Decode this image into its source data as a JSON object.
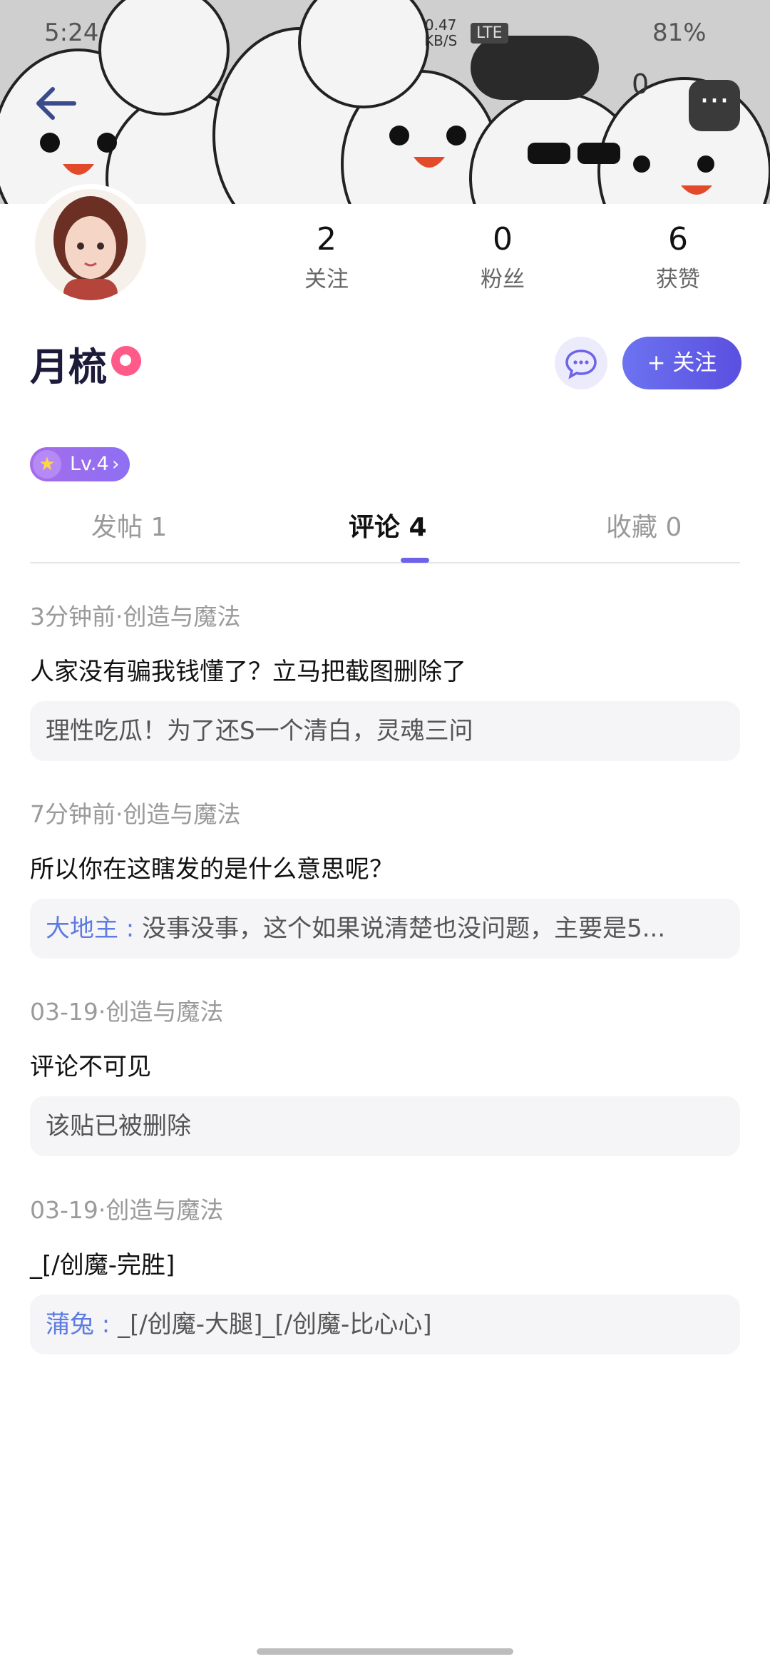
{
  "status_bar": {
    "time": "5:24",
    "net_speed": "0.47",
    "net_unit": "KB/S",
    "network": "LTE",
    "battery": "81%"
  },
  "header": {
    "notification_count": "0",
    "more_icon": "more-icon",
    "back_icon": "back-arrow-icon"
  },
  "profile": {
    "name": "月梳",
    "level": "Lv.4",
    "stats": [
      {
        "value": "2",
        "label": "关注"
      },
      {
        "value": "0",
        "label": "粉丝"
      },
      {
        "value": "6",
        "label": "获赞"
      }
    ],
    "follow_label": "+ 关注"
  },
  "tabs": [
    {
      "label": "发帖 1",
      "active": false
    },
    {
      "label": "评论 4",
      "active": true
    },
    {
      "label": "收藏 0",
      "active": false
    }
  ],
  "comments": [
    {
      "meta": "3分钟前·创造与魔法",
      "content": "人家没有骗我钱懂了？立马把截图删除了",
      "quote_author": "",
      "quote_text": "理性吃瓜！为了还S一个清白，灵魂三问"
    },
    {
      "meta": "7分钟前·创造与魔法",
      "content": "所以你在这瞎发的是什么意思呢？",
      "quote_author": "大地主 : ",
      "quote_text": "没事没事，这个如果说清楚也没问题，主要是5..."
    },
    {
      "meta": "03-19·创造与魔法",
      "content": "评论不可见",
      "quote_author": "",
      "quote_text": "该贴已被删除"
    },
    {
      "meta": "03-19·创造与魔法",
      "content": "_[/创魔-完胜]",
      "quote_author": "蒲兔 : ",
      "quote_text": "_[/创魔-大腿]_[/创魔-比心心]"
    }
  ],
  "colors": {
    "accent": "#6c63ea",
    "quote_author": "#5d7be0"
  }
}
